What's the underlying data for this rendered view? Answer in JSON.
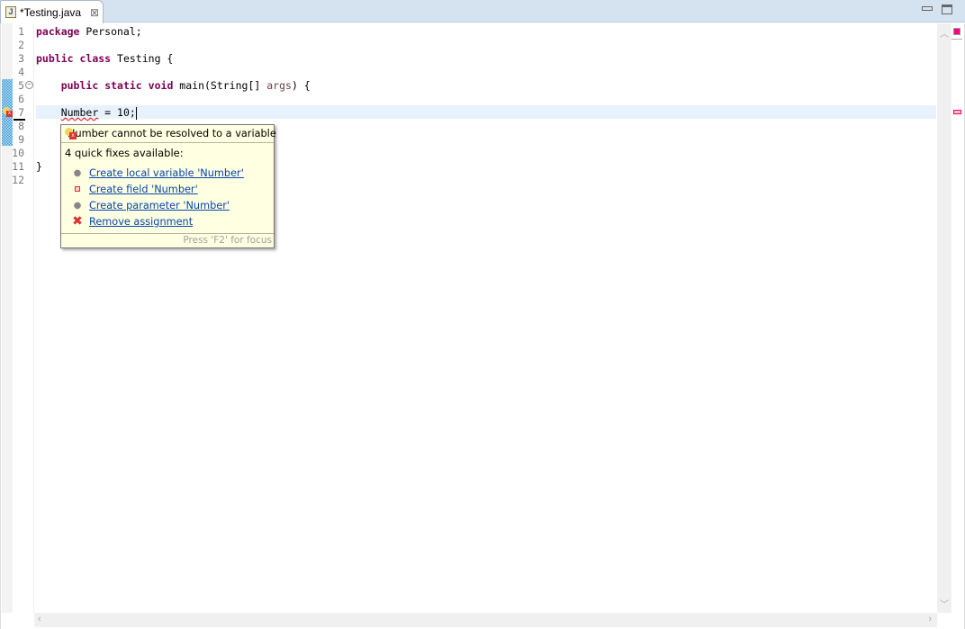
{
  "tab": {
    "title": "*Testing.java",
    "icon": "java-file-icon"
  },
  "editor": {
    "line_numbers": [
      "1",
      "2",
      "3",
      "4",
      "5",
      "6",
      "7",
      "8",
      "9",
      "10",
      "11",
      "12"
    ],
    "lines": {
      "l1": {
        "kw": "package",
        "rest": " Personal;"
      },
      "l3": {
        "kw1": "public",
        "kw2": "class",
        "rest": " Testing {"
      },
      "l5": {
        "kw1": "public",
        "kw2": "static",
        "kw3": "void",
        "rest1": " main(String[] ",
        "arg": "args",
        "rest2": ") {"
      },
      "l7": {
        "err": "Number",
        "rest": " = 10;"
      },
      "l11": {
        "rest": "}"
      }
    }
  },
  "popup": {
    "title": "Number cannot be resolved to a variable",
    "count": "4 quick fixes available:",
    "fixes": [
      {
        "label": "Create local variable 'Number'",
        "icon": "local-variable-icon"
      },
      {
        "label": "Create field 'Number'",
        "icon": "field-icon"
      },
      {
        "label": "Create parameter 'Number'",
        "icon": "local-variable-icon"
      },
      {
        "label": "Remove assignment",
        "icon": "remove-icon"
      }
    ],
    "footer": "Press 'F2' for focus"
  },
  "colors": {
    "error": "#ff0080",
    "keyword": "#7f0055"
  }
}
